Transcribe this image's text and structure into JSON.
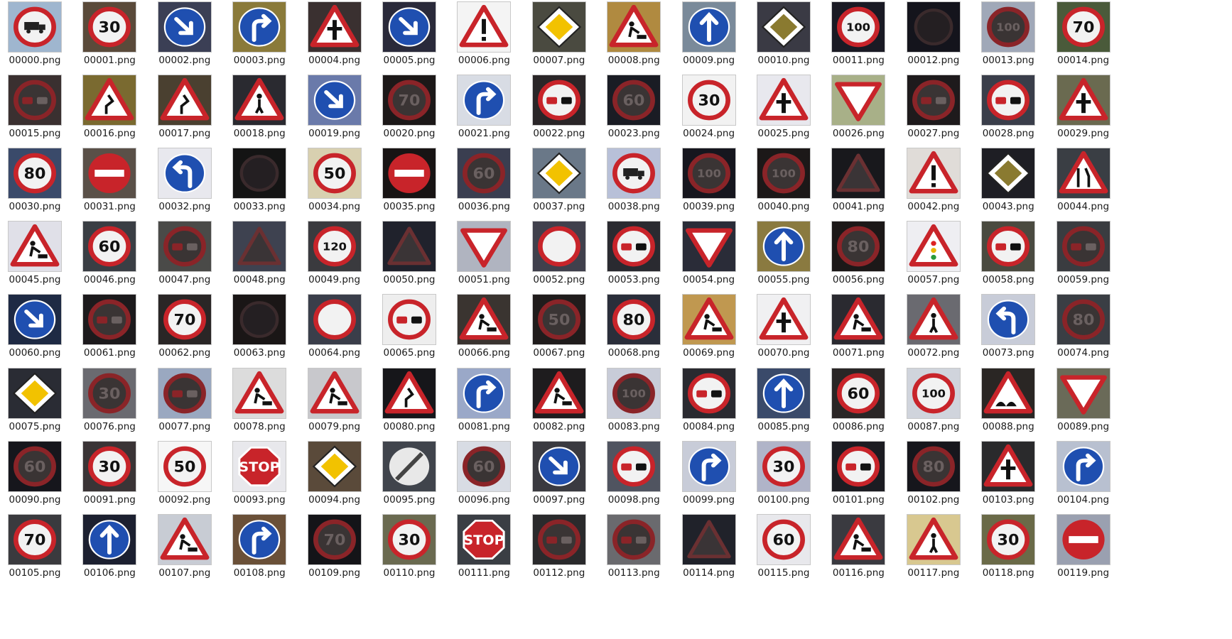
{
  "files": [
    {
      "name": "00000.png",
      "icon": "truck-prohibited-sign-icon",
      "kind": "circle-truck",
      "bg": "#9fb6cf"
    },
    {
      "name": "00001.png",
      "icon": "speed-limit-sign-icon",
      "kind": "speed",
      "text": "30",
      "bg": "#5a4a3a"
    },
    {
      "name": "00002.png",
      "icon": "keep-right-sign-icon",
      "kind": "blue-arrow-dr",
      "bg": "#3b3f55"
    },
    {
      "name": "00003.png",
      "icon": "turn-right-ahead-sign-icon",
      "kind": "blue-turn-right",
      "bg": "#8a7a3a"
    },
    {
      "name": "00004.png",
      "icon": "right-of-way-warning-sign-icon",
      "kind": "tri-cross",
      "bg": "#3a3030"
    },
    {
      "name": "00005.png",
      "icon": "keep-right-sign-icon",
      "kind": "blue-arrow-dr",
      "bg": "#2a2a3a"
    },
    {
      "name": "00006.png",
      "icon": "general-caution-sign-icon",
      "kind": "tri-excl",
      "bg": "#f4f4f4"
    },
    {
      "name": "00007.png",
      "icon": "priority-road-sign-icon",
      "kind": "diamond",
      "bg": "#4a4a40"
    },
    {
      "name": "00008.png",
      "icon": "road-work-sign-icon",
      "kind": "tri-work",
      "bg": "#b08a40"
    },
    {
      "name": "00009.png",
      "icon": "ahead-only-sign-icon",
      "kind": "blue-up",
      "bg": "#7a8a9a"
    },
    {
      "name": "00010.png",
      "icon": "priority-road-sign-icon",
      "kind": "diamond-dark",
      "bg": "#3a3a44"
    },
    {
      "name": "00011.png",
      "icon": "speed-limit-sign-icon",
      "kind": "speed",
      "text": "100",
      "bg": "#1a1a24"
    },
    {
      "name": "00012.png",
      "icon": "dark-sign-icon",
      "kind": "dark",
      "bg": "#14141c"
    },
    {
      "name": "00013.png",
      "icon": "speed-limit-sign-icon",
      "kind": "speed-dark",
      "text": "100",
      "bg": "#a0a8b8"
    },
    {
      "name": "00014.png",
      "icon": "speed-limit-sign-icon",
      "kind": "speed",
      "text": "70",
      "bg": "#4a5a3a"
    },
    {
      "name": "00015.png",
      "icon": "no-passing-sign-icon",
      "kind": "no-passing-dark",
      "bg": "#3a3030"
    },
    {
      "name": "00016.png",
      "icon": "double-curve-sign-icon",
      "kind": "tri-curve",
      "bg": "#7a6a30"
    },
    {
      "name": "00017.png",
      "icon": "dangerous-curve-sign-icon",
      "kind": "tri-curve",
      "bg": "#4a4030"
    },
    {
      "name": "00018.png",
      "icon": "pedestrians-sign-icon",
      "kind": "tri-ped",
      "bg": "#2a2a30"
    },
    {
      "name": "00019.png",
      "icon": "keep-right-sign-icon",
      "kind": "blue-arrow-dr",
      "bg": "#6a7aaa"
    },
    {
      "name": "00020.png",
      "icon": "speed-limit-sign-icon",
      "kind": "speed-dark",
      "text": "70",
      "bg": "#1c1818"
    },
    {
      "name": "00021.png",
      "icon": "turn-right-ahead-sign-icon",
      "kind": "blue-turn-right",
      "bg": "#d8dce4"
    },
    {
      "name": "00022.png",
      "icon": "no-passing-sign-icon",
      "kind": "no-passing",
      "bg": "#2a2628"
    },
    {
      "name": "00023.png",
      "icon": "speed-limit-sign-icon",
      "kind": "speed-dark",
      "text": "60",
      "bg": "#1a1c24"
    },
    {
      "name": "00024.png",
      "icon": "speed-limit-sign-icon",
      "kind": "speed",
      "text": "30",
      "bg": "#f2f2f2"
    },
    {
      "name": "00025.png",
      "icon": "right-of-way-warning-sign-icon",
      "kind": "tri-cross",
      "bg": "#e8e8ee"
    },
    {
      "name": "00026.png",
      "icon": "yield-sign-icon",
      "kind": "yield",
      "bg": "#a8b088"
    },
    {
      "name": "00027.png",
      "icon": "no-trucks-passing-sign-icon",
      "kind": "no-passing-dark",
      "bg": "#1e1a1c"
    },
    {
      "name": "00028.png",
      "icon": "no-passing-sign-icon",
      "kind": "no-passing",
      "bg": "#3a3e4a"
    },
    {
      "name": "00029.png",
      "icon": "general-caution-sign-icon",
      "kind": "tri-cross",
      "bg": "#6a6a50"
    },
    {
      "name": "00030.png",
      "icon": "speed-limit-sign-icon",
      "kind": "speed",
      "text": "80",
      "bg": "#3a4a6a"
    },
    {
      "name": "00031.png",
      "icon": "no-entry-sign-icon",
      "kind": "no-entry",
      "bg": "#5a5048"
    },
    {
      "name": "00032.png",
      "icon": "turn-left-ahead-sign-icon",
      "kind": "blue-turn-left",
      "bg": "#e8e8ee"
    },
    {
      "name": "00033.png",
      "icon": "dark-sign-icon",
      "kind": "dark",
      "bg": "#141414"
    },
    {
      "name": "00034.png",
      "icon": "speed-limit-sign-icon",
      "kind": "speed",
      "text": "50",
      "bg": "#d8d0b0"
    },
    {
      "name": "00035.png",
      "icon": "no-entry-sign-icon",
      "kind": "no-entry",
      "bg": "#181414"
    },
    {
      "name": "00036.png",
      "icon": "speed-limit-sign-icon",
      "kind": "speed-dark",
      "text": "60",
      "bg": "#3a3e50"
    },
    {
      "name": "00037.png",
      "icon": "priority-road-sign-icon",
      "kind": "diamond",
      "bg": "#6a7888"
    },
    {
      "name": "00038.png",
      "icon": "truck-prohibited-sign-icon",
      "kind": "circle-truck",
      "bg": "#b8c0d8"
    },
    {
      "name": "00039.png",
      "icon": "speed-limit-sign-icon",
      "kind": "speed-dark",
      "text": "100",
      "bg": "#16161e"
    },
    {
      "name": "00040.png",
      "icon": "speed-limit-sign-icon",
      "kind": "speed-dark",
      "text": "100",
      "bg": "#1c1818"
    },
    {
      "name": "00041.png",
      "icon": "right-of-way-warning-sign-icon",
      "kind": "tri-dark",
      "bg": "#18181c"
    },
    {
      "name": "00042.png",
      "icon": "general-caution-sign-icon",
      "kind": "tri-excl",
      "bg": "#e0dcd8"
    },
    {
      "name": "00043.png",
      "icon": "priority-road-sign-icon",
      "kind": "diamond-dark",
      "bg": "#1e1e24"
    },
    {
      "name": "00044.png",
      "icon": "road-narrows-sign-icon",
      "kind": "tri-narrow",
      "bg": "#3a3e44"
    },
    {
      "name": "00045.png",
      "icon": "road-work-sign-icon",
      "kind": "tri-work",
      "bg": "#e0e0e8"
    },
    {
      "name": "00046.png",
      "icon": "speed-limit-sign-icon",
      "kind": "speed",
      "text": "60",
      "bg": "#3a3e44"
    },
    {
      "name": "00047.png",
      "icon": "no-trucks-passing-sign-icon",
      "kind": "no-passing-dark",
      "bg": "#4a4a48"
    },
    {
      "name": "00048.png",
      "icon": "warning-sign-icon",
      "kind": "tri-dark",
      "bg": "#3e4250"
    },
    {
      "name": "00049.png",
      "icon": "speed-limit-sign-icon",
      "kind": "speed",
      "text": "120",
      "bg": "#3a3a3e"
    },
    {
      "name": "00050.png",
      "icon": "warning-sign-icon",
      "kind": "tri-dark",
      "bg": "#20222c"
    },
    {
      "name": "00051.png",
      "icon": "yield-sign-icon",
      "kind": "yield",
      "bg": "#b0b4c0"
    },
    {
      "name": "00052.png",
      "icon": "no-vehicles-sign-icon",
      "kind": "no-vehicles",
      "bg": "#40404c"
    },
    {
      "name": "00053.png",
      "icon": "no-passing-sign-icon",
      "kind": "no-passing",
      "bg": "#2a2a30"
    },
    {
      "name": "00054.png",
      "icon": "yield-sign-icon",
      "kind": "yield",
      "bg": "#2a2c38"
    },
    {
      "name": "00055.png",
      "icon": "ahead-only-sign-icon",
      "kind": "blue-up",
      "bg": "#8a7a40"
    },
    {
      "name": "00056.png",
      "icon": "speed-limit-sign-icon",
      "kind": "speed-dark",
      "text": "80",
      "bg": "#1c1818"
    },
    {
      "name": "00057.png",
      "icon": "traffic-signals-sign-icon",
      "kind": "tri-signals",
      "bg": "#eeeef2"
    },
    {
      "name": "00058.png",
      "icon": "no-passing-sign-icon",
      "kind": "no-passing",
      "bg": "#4a4a40"
    },
    {
      "name": "00059.png",
      "icon": "no-trucks-passing-sign-icon",
      "kind": "no-passing-dark",
      "bg": "#3a3c40"
    },
    {
      "name": "00060.png",
      "icon": "keep-right-sign-icon",
      "kind": "blue-arrow-dr",
      "bg": "#1e2a44"
    },
    {
      "name": "00061.png",
      "icon": "no-trucks-passing-sign-icon",
      "kind": "no-passing-dark",
      "bg": "#1c1a1c"
    },
    {
      "name": "00062.png",
      "icon": "speed-limit-sign-icon",
      "kind": "speed",
      "text": "70",
      "bg": "#2a2626"
    },
    {
      "name": "00063.png",
      "icon": "dark-sign-icon",
      "kind": "dark",
      "bg": "#1a1616"
    },
    {
      "name": "00064.png",
      "icon": "no-vehicles-sign-icon",
      "kind": "no-vehicles",
      "bg": "#3a3e4a"
    },
    {
      "name": "00065.png",
      "icon": "no-passing-sign-icon",
      "kind": "no-passing",
      "bg": "#eeeeee"
    },
    {
      "name": "00066.png",
      "icon": "road-work-sign-icon",
      "kind": "tri-work",
      "bg": "#3a3430"
    },
    {
      "name": "00067.png",
      "icon": "speed-limit-sign-icon",
      "kind": "speed-dark",
      "text": "50",
      "bg": "#201c1c"
    },
    {
      "name": "00068.png",
      "icon": "speed-limit-sign-icon",
      "kind": "speed",
      "text": "80",
      "bg": "#2a2e3a"
    },
    {
      "name": "00069.png",
      "icon": "road-work-sign-icon",
      "kind": "tri-work",
      "bg": "#c09850"
    },
    {
      "name": "00070.png",
      "icon": "right-of-way-warning-sign-icon",
      "kind": "tri-cross",
      "bg": "#f0f0f2"
    },
    {
      "name": "00071.png",
      "icon": "road-work-sign-icon",
      "kind": "tri-work",
      "bg": "#2a2a30"
    },
    {
      "name": "00072.png",
      "icon": "pedestrians-sign-icon",
      "kind": "tri-ped",
      "bg": "#6a6a70"
    },
    {
      "name": "00073.png",
      "icon": "turn-left-ahead-sign-icon",
      "kind": "blue-turn-left",
      "bg": "#c8ccd8"
    },
    {
      "name": "00074.png",
      "icon": "speed-limit-sign-icon",
      "kind": "speed-dark",
      "text": "80",
      "bg": "#3a3e44"
    },
    {
      "name": "00075.png",
      "icon": "priority-road-sign-icon",
      "kind": "diamond",
      "bg": "#2a2c34"
    },
    {
      "name": "00076.png",
      "icon": "speed-limit-sign-icon",
      "kind": "speed-dark",
      "text": "30",
      "bg": "#6a6a70"
    },
    {
      "name": "00077.png",
      "icon": "no-trucks-passing-sign-icon",
      "kind": "no-passing-dark",
      "bg": "#9aa8c0"
    },
    {
      "name": "00078.png",
      "icon": "road-work-sign-icon",
      "kind": "tri-work",
      "bg": "#dcdcdc"
    },
    {
      "name": "00079.png",
      "icon": "road-work-sign-icon",
      "kind": "tri-work",
      "bg": "#c8c8cc"
    },
    {
      "name": "00080.png",
      "icon": "double-curve-sign-icon",
      "kind": "tri-curve",
      "bg": "#16161a"
    },
    {
      "name": "00081.png",
      "icon": "turn-right-ahead-sign-icon",
      "kind": "blue-turn-right",
      "bg": "#9aa8c8"
    },
    {
      "name": "00082.png",
      "icon": "road-work-sign-icon",
      "kind": "tri-work",
      "bg": "#1e1c1e"
    },
    {
      "name": "00083.png",
      "icon": "speed-limit-sign-icon",
      "kind": "speed-dark",
      "text": "100",
      "bg": "#c8ccd8"
    },
    {
      "name": "00084.png",
      "icon": "no-trucks-passing-sign-icon",
      "kind": "no-passing",
      "bg": "#2a2a30"
    },
    {
      "name": "00085.png",
      "icon": "ahead-only-sign-icon",
      "kind": "blue-up",
      "bg": "#3a4a6a"
    },
    {
      "name": "00086.png",
      "icon": "speed-limit-sign-icon",
      "kind": "speed",
      "text": "60",
      "bg": "#2a2626"
    },
    {
      "name": "00087.png",
      "icon": "speed-limit-sign-icon",
      "kind": "speed",
      "text": "100",
      "bg": "#d0d4dc"
    },
    {
      "name": "00088.png",
      "icon": "bumpy-road-sign-icon",
      "kind": "tri-bump",
      "bg": "#2a2624"
    },
    {
      "name": "00089.png",
      "icon": "yield-sign-icon",
      "kind": "yield",
      "bg": "#6a6a58"
    },
    {
      "name": "00090.png",
      "icon": "speed-limit-sign-icon",
      "kind": "speed-dark",
      "text": "60",
      "bg": "#16161c"
    },
    {
      "name": "00091.png",
      "icon": "speed-limit-sign-icon",
      "kind": "speed",
      "text": "30",
      "bg": "#3a3436"
    },
    {
      "name": "00092.png",
      "icon": "speed-limit-sign-icon",
      "kind": "speed",
      "text": "50",
      "bg": "#f6f6f6"
    },
    {
      "name": "00093.png",
      "icon": "stop-sign-icon",
      "kind": "stop",
      "bg": "#e8e8ec"
    },
    {
      "name": "00094.png",
      "icon": "priority-road-sign-icon",
      "kind": "diamond",
      "bg": "#5a4a3a"
    },
    {
      "name": "00095.png",
      "icon": "end-of-restrictions-sign-icon",
      "kind": "end-restr",
      "bg": "#40444c"
    },
    {
      "name": "00096.png",
      "icon": "speed-limit-sign-icon",
      "kind": "speed-dark",
      "text": "60",
      "bg": "#d8dce4"
    },
    {
      "name": "00097.png",
      "icon": "keep-right-sign-icon",
      "kind": "blue-arrow-dr",
      "bg": "#3a3a40"
    },
    {
      "name": "00098.png",
      "icon": "no-passing-sign-icon",
      "kind": "no-passing",
      "bg": "#505460"
    },
    {
      "name": "00099.png",
      "icon": "turn-right-ahead-sign-icon",
      "kind": "blue-turn-right",
      "bg": "#c8ccd8"
    },
    {
      "name": "00100.png",
      "icon": "speed-limit-sign-icon",
      "kind": "speed",
      "text": "30",
      "bg": "#b0b4c8"
    },
    {
      "name": "00101.png",
      "icon": "no-trucks-passing-sign-icon",
      "kind": "no-passing",
      "bg": "#1c1c22"
    },
    {
      "name": "00102.png",
      "icon": "speed-limit-sign-icon",
      "kind": "speed-dark",
      "text": "80",
      "bg": "#16161c"
    },
    {
      "name": "00103.png",
      "icon": "right-of-way-warning-sign-icon",
      "kind": "tri-cross",
      "bg": "#2a2a2c"
    },
    {
      "name": "00104.png",
      "icon": "turn-right-ahead-sign-icon",
      "kind": "blue-turn-right",
      "bg": "#b8c0d0"
    },
    {
      "name": "00105.png",
      "icon": "speed-limit-sign-icon",
      "kind": "speed",
      "text": "70",
      "bg": "#3a3a3e"
    },
    {
      "name": "00106.png",
      "icon": "ahead-only-sign-icon",
      "kind": "blue-up",
      "bg": "#1c2030"
    },
    {
      "name": "00107.png",
      "icon": "road-work-sign-icon",
      "kind": "tri-work",
      "bg": "#c8ccd4"
    },
    {
      "name": "00108.png",
      "icon": "turn-right-ahead-sign-icon",
      "kind": "blue-turn-right",
      "bg": "#6a5038"
    },
    {
      "name": "00109.png",
      "icon": "speed-limit-sign-icon",
      "kind": "speed-dark",
      "text": "70",
      "bg": "#141418"
    },
    {
      "name": "00110.png",
      "icon": "speed-limit-sign-icon",
      "kind": "speed",
      "text": "30",
      "bg": "#6a6a50"
    },
    {
      "name": "00111.png",
      "icon": "stop-sign-icon",
      "kind": "stop",
      "bg": "#3a3e44"
    },
    {
      "name": "00112.png",
      "icon": "no-trucks-passing-sign-icon",
      "kind": "no-passing-dark",
      "bg": "#2a2a2c"
    },
    {
      "name": "00113.png",
      "icon": "no-trucks-passing-sign-icon",
      "kind": "no-passing-dark",
      "bg": "#6a6a6e"
    },
    {
      "name": "00114.png",
      "icon": "warning-sign-icon",
      "kind": "tri-dark",
      "bg": "#20222a"
    },
    {
      "name": "00115.png",
      "icon": "speed-limit-sign-icon",
      "kind": "speed",
      "text": "60",
      "bg": "#e8e8ec"
    },
    {
      "name": "00116.png",
      "icon": "road-work-sign-icon",
      "kind": "tri-work",
      "bg": "#3a3a40"
    },
    {
      "name": "00117.png",
      "icon": "pedestrians-sign-icon",
      "kind": "tri-ped",
      "bg": "#d8c890"
    },
    {
      "name": "00118.png",
      "icon": "speed-limit-sign-icon",
      "kind": "speed",
      "text": "30",
      "bg": "#6a6a48"
    },
    {
      "name": "00119.png",
      "icon": "no-entry-sign-icon",
      "kind": "no-entry",
      "bg": "#9aa0b0"
    }
  ]
}
